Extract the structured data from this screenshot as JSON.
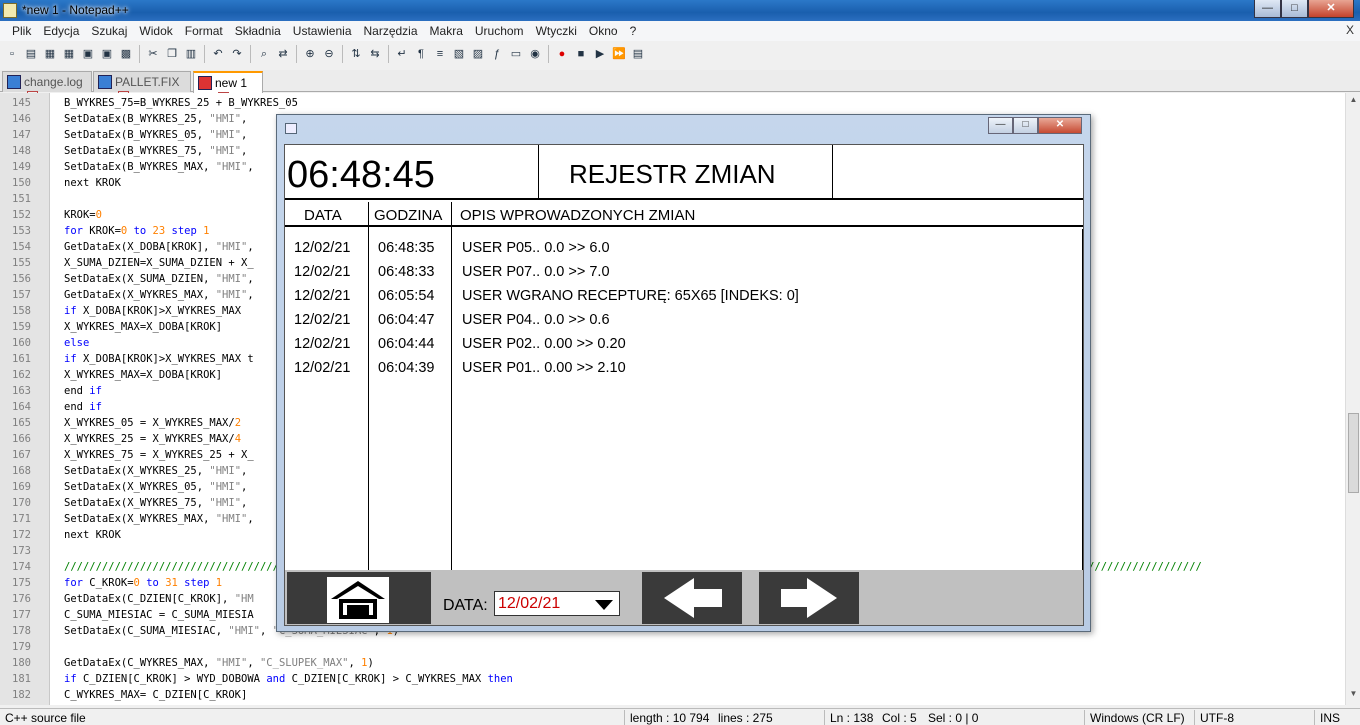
{
  "window": {
    "title": "*new 1 - Notepad++",
    "min": "—",
    "max": "□",
    "close": "✕"
  },
  "menu": [
    "Plik",
    "Edycja",
    "Szukaj",
    "Widok",
    "Format",
    "Składnia",
    "Ustawienia",
    "Narzędzia",
    "Makra",
    "Uruchom",
    "Wtyczki",
    "Okno",
    "?"
  ],
  "menu_close": "X",
  "toolbar_icons": [
    "new-file-icon",
    "open-file-icon",
    "save-icon",
    "save-all-icon",
    "close-icon",
    "close-all-icon",
    "print-icon",
    "cut-icon",
    "copy-icon",
    "paste-icon",
    "undo-icon",
    "redo-icon",
    "find-icon",
    "replace-icon",
    "zoom-in-icon",
    "zoom-out-icon",
    "sync-v-icon",
    "sync-h-icon",
    "wrap-icon",
    "all-chars-icon",
    "indent-guide-icon",
    "udl-icon",
    "doc-map-icon",
    "function-list-icon",
    "folder-icon",
    "monitor-icon",
    "record-macro-icon",
    "stop-macro-icon",
    "play-macro-icon",
    "run-macro-multi-icon",
    "save-macro-icon"
  ],
  "tabs": [
    {
      "label": "change.log",
      "close": "x"
    },
    {
      "label": "PALLET.FIX",
      "close": "x"
    },
    {
      "label": "new 1",
      "close": "x"
    }
  ],
  "code_lines": [
    {
      "n": "145",
      "html": "B_WYKRES_75=B_WYKRES_25 + B_WYKRES_05"
    },
    {
      "n": "146",
      "html": "SetDataEx(B_WYKRES_25, <span class='str'>\"HMI\"</span>,"
    },
    {
      "n": "147",
      "html": "SetDataEx(B_WYKRES_05, <span class='str'>\"HMI\"</span>,"
    },
    {
      "n": "148",
      "html": "SetDataEx(B_WYKRES_75, <span class='str'>\"HMI\"</span>,"
    },
    {
      "n": "149",
      "html": "SetDataEx(B_WYKRES_MAX, <span class='str'>\"HMI\"</span>,"
    },
    {
      "n": "150",
      "html": "next KROK"
    },
    {
      "n": "151",
      "html": ""
    },
    {
      "n": "152",
      "html": "KROK=<span class='num'>0</span>"
    },
    {
      "n": "153",
      "html": "<span class='kw'>for</span> KROK=<span class='num'>0</span> <span class='kw'>to</span> <span class='num'>23</span> <span class='kw'>step</span> <span class='num'>1</span>"
    },
    {
      "n": "154",
      "html": "GetDataEx(X_DOBA[KROK], <span class='str'>\"HMI\"</span>,"
    },
    {
      "n": "155",
      "html": "X_SUMA_DZIEN=X_SUMA_DZIEN + X_"
    },
    {
      "n": "156",
      "html": "SetDataEx(X_SUMA_DZIEN, <span class='str'>\"HMI\"</span>,"
    },
    {
      "n": "157",
      "html": "GetDataEx(X_WYKRES_MAX, <span class='str'>\"HMI\"</span>,"
    },
    {
      "n": "158",
      "html": "<span class='kw'>if</span> X_DOBA[KROK]&gt;X_WYKRES_MAX"
    },
    {
      "n": "159",
      "html": "X_WYKRES_MAX=X_DOBA[KROK]"
    },
    {
      "n": "160",
      "html": "<span class='kw'>else</span>"
    },
    {
      "n": "161",
      "html": "<span class='kw'>if</span> X_DOBA[KROK]&gt;X_WYKRES_MAX t"
    },
    {
      "n": "162",
      "html": "X_WYKRES_MAX=X_DOBA[KROK]"
    },
    {
      "n": "163",
      "html": "end <span class='kw'>if</span>"
    },
    {
      "n": "164",
      "html": "end <span class='kw'>if</span>"
    },
    {
      "n": "165",
      "html": "X_WYKRES_05 = X_WYKRES_MAX/<span class='num'>2</span>"
    },
    {
      "n": "166",
      "html": "X_WYKRES_25 = X_WYKRES_MAX/<span class='num'>4</span>"
    },
    {
      "n": "167",
      "html": "X_WYKRES_75 = X_WYKRES_25 + X_"
    },
    {
      "n": "168",
      "html": "SetDataEx(X_WYKRES_25, <span class='str'>\"HMI\"</span>,"
    },
    {
      "n": "169",
      "html": "SetDataEx(X_WYKRES_05, <span class='str'>\"HMI\"</span>,"
    },
    {
      "n": "170",
      "html": "SetDataEx(X_WYKRES_75, <span class='str'>\"HMI\"</span>,"
    },
    {
      "n": "171",
      "html": "SetDataEx(X_WYKRES_MAX, <span class='str'>\"HMI\"</span>,"
    },
    {
      "n": "172",
      "html": "next KROK"
    },
    {
      "n": "173",
      "html": ""
    },
    {
      "n": "174",
      "html": "<span class='cmt'>////////////////////////////////////////////////////////////////////////////////////////////////////////////////////////////////////////////////////////////////////////////////////</span>"
    },
    {
      "n": "175",
      "html": "<span class='kw'>for</span> C_KROK=<span class='num'>0</span> <span class='kw'>to</span> <span class='num'>31</span> <span class='kw'>step</span> <span class='num'>1</span>"
    },
    {
      "n": "176",
      "html": "GetDataEx(C_DZIEN[C_KROK], <span class='str'>\"HM</span>"
    },
    {
      "n": "177",
      "html": "C_SUMA_MIESIAC = C_SUMA_MIESIA"
    },
    {
      "n": "178",
      "html": "SetDataEx(C_SUMA_MIESIAC, <span class='str'>\"HMI\"</span>, <span class='str'>\"C_SUMA_MIESIAC\"</span>, <span class='num'>1</span>)"
    },
    {
      "n": "179",
      "html": ""
    },
    {
      "n": "180",
      "html": "GetDataEx(C_WYKRES_MAX, <span class='str'>\"HMI\"</span>, <span class='str'>\"C_SLUPEK_MAX\"</span>, <span class='num'>1</span>)"
    },
    {
      "n": "181",
      "html": "<span class='kw'>if</span> C_DZIEN[C_KROK] &gt; WYD_DOBOWA <span class='kw'>and</span> C_DZIEN[C_KROK] &gt; C_WYKRES_MAX <span class='kw'>then</span>"
    },
    {
      "n": "182",
      "html": "C_WYKRES_MAX= C_DZIEN[C_KROK]"
    }
  ],
  "status": {
    "lang": "C++ source file",
    "length": "length : 10 794",
    "lines": "lines : 275",
    "ln": "Ln : 138",
    "col": "Col : 5",
    "sel": "Sel : 0 | 0",
    "eol": "Windows (CR LF)",
    "enc": "UTF-8",
    "mode": "INS"
  },
  "dialog": {
    "clock": "06:48:45",
    "title": "REJESTR  ZMIAN",
    "col_date": "DATA",
    "col_time": "GODZINA",
    "col_desc": "OPIS WPROWADZONYCH ZMIAN",
    "rows": [
      {
        "date": "12/02/21",
        "time": "06:48:35",
        "desc": "USER  P05.. 0.0  >>  6.0"
      },
      {
        "date": "12/02/21",
        "time": "06:48:33",
        "desc": "USER  P07.. 0.0  >>  7.0"
      },
      {
        "date": "12/02/21",
        "time": "06:05:54",
        "desc": "USER  WGRANO RECEPTURĘ: 65X65  [INDEKS: 0]"
      },
      {
        "date": "12/02/21",
        "time": "06:04:47",
        "desc": "USER  P04.. 0.0  >>  0.6"
      },
      {
        "date": "12/02/21",
        "time": "06:04:44",
        "desc": "USER  P02.. 0.00  >>  0.20"
      },
      {
        "date": "12/02/21",
        "time": "06:04:39",
        "desc": "USER  P01.. 0.00  >>  2.10"
      }
    ],
    "date_label": "DATA:",
    "date_value": "12/02/21"
  }
}
